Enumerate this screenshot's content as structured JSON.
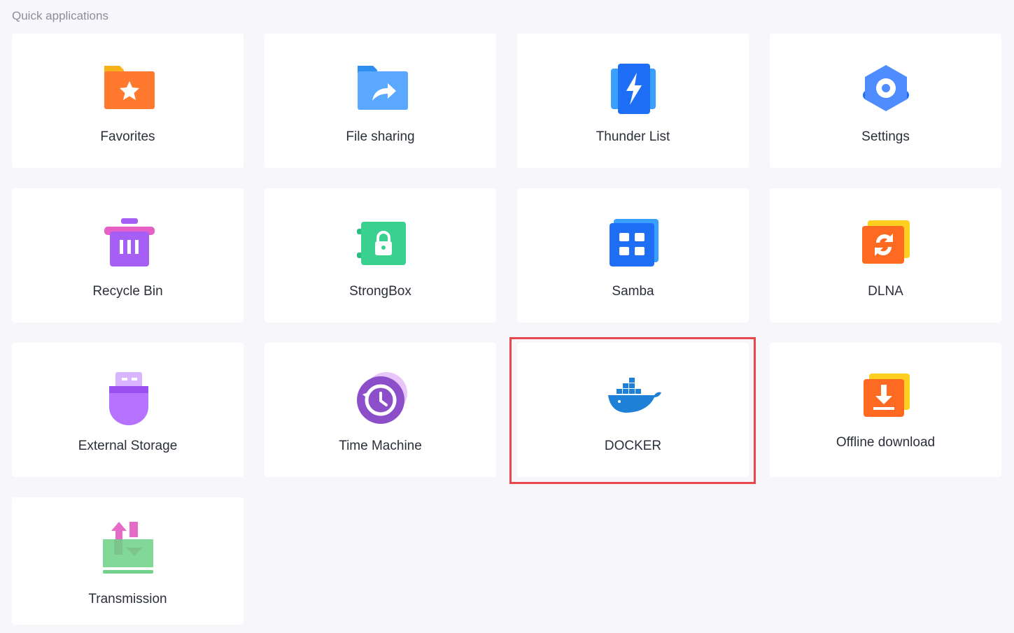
{
  "section": {
    "title": "Quick applications"
  },
  "apps": [
    {
      "label": "Favorites",
      "icon": "favorites-folder-star-icon"
    },
    {
      "label": "File sharing",
      "icon": "file-sharing-folder-icon"
    },
    {
      "label": "Thunder List",
      "icon": "thunder-lightning-icon"
    },
    {
      "label": "Settings",
      "icon": "settings-gear-icon"
    },
    {
      "label": "Recycle Bin",
      "icon": "recycle-bin-trash-icon"
    },
    {
      "label": "StrongBox",
      "icon": "strongbox-lock-icon"
    },
    {
      "label": "Samba",
      "icon": "samba-share-icon"
    },
    {
      "label": "DLNA",
      "icon": "dlna-sync-icon"
    },
    {
      "label": "External Storage",
      "icon": "usb-drive-icon"
    },
    {
      "label": "Time Machine",
      "icon": "time-machine-clock-icon"
    },
    {
      "label": "DOCKER",
      "icon": "docker-whale-icon"
    },
    {
      "label": "Offline download",
      "icon": "offline-download-icon"
    },
    {
      "label": "Transmission",
      "icon": "transmission-transfer-icon"
    }
  ],
  "colors": {
    "background": "#f7f7fb",
    "tile": "#ffffff",
    "highlight": "#e8474d"
  }
}
